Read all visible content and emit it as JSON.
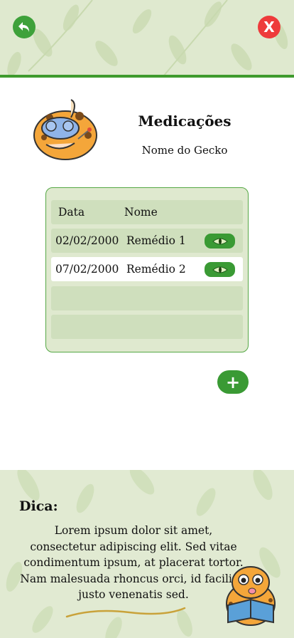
{
  "header": {
    "back_icon": "undo-arrow-icon",
    "close_icon": "close-x-icon",
    "close_label": "X"
  },
  "page": {
    "title": "Medicações",
    "subtitle": "Nome do Gecko"
  },
  "table": {
    "headers": [
      "Data",
      "Nome"
    ],
    "rows": [
      {
        "date": "02/02/2000",
        "name": "Remédio 1",
        "action_icon": "eye-icon"
      },
      {
        "date": "07/02/2000",
        "name": "Remédio 2",
        "action_icon": "eye-icon"
      }
    ],
    "empty_rows": 2
  },
  "add_button": {
    "icon": "plus-icon",
    "label": "+"
  },
  "tip": {
    "label": "Dica:",
    "text": "Lorem ipsum dolor sit amet, consectetur adipiscing elit. Sed vitae condimentum ipsum, at placerat tortor. Nam malesuada rhoncus orci, id facilisis justo venenatis sed."
  },
  "colors": {
    "accent_green": "#3a9a34",
    "header_bg": "#dfe9cf",
    "row_bg": "#cfdfbd",
    "close_red": "#ee3b3b"
  }
}
